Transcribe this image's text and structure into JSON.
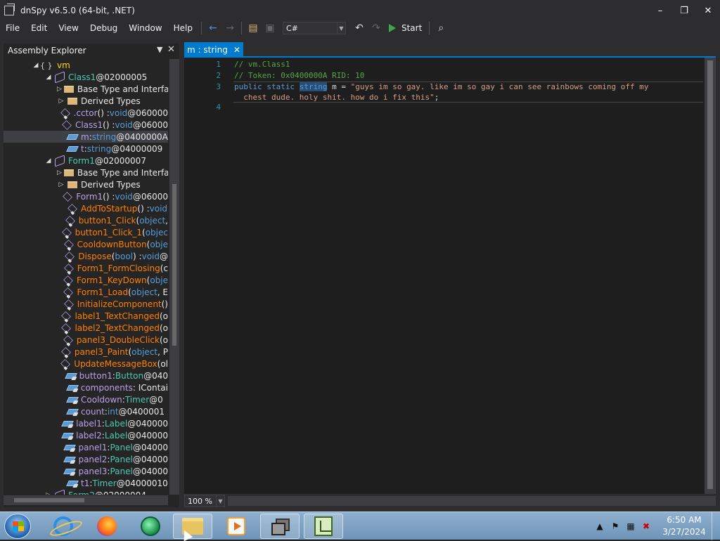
{
  "window": {
    "title": "dnSpy v6.5.0 (64-bit, .NET)"
  },
  "menu": [
    "File",
    "Edit",
    "View",
    "Debug",
    "Window",
    "Help"
  ],
  "toolbar": {
    "language": "C#",
    "start_label": "Start"
  },
  "explorer": {
    "title": "Assembly Explorer"
  },
  "tree": [
    {
      "indent": 48,
      "expand": "◢",
      "icon": "ns",
      "segments": [
        {
          "t": "vm",
          "c": "t-ns"
        }
      ]
    },
    {
      "indent": 66,
      "expand": "◢",
      "icon": "class",
      "segments": [
        {
          "t": "Class1",
          "c": "t-type"
        },
        {
          "t": " @02000005",
          "c": "t-token"
        }
      ]
    },
    {
      "indent": 84,
      "expand": "▷",
      "icon": "folder",
      "segments": [
        {
          "t": "Base Type and Interfac",
          "c": "t-white"
        }
      ]
    },
    {
      "indent": 84,
      "expand": "▷",
      "icon": "folder",
      "segments": [
        {
          "t": "Derived Types",
          "c": "t-white"
        }
      ]
    },
    {
      "indent": 84,
      "expand": "",
      "icon": "method-lock",
      "segments": [
        {
          "t": ".cctor",
          "c": "t-methodp"
        },
        {
          "t": "() : ",
          "c": "t-white"
        },
        {
          "t": "void",
          "c": "t-kw"
        },
        {
          "t": " @060000",
          "c": "t-token"
        }
      ]
    },
    {
      "indent": 84,
      "expand": "",
      "icon": "method",
      "segments": [
        {
          "t": "Class1",
          "c": "t-methodp"
        },
        {
          "t": "() : ",
          "c": "t-white"
        },
        {
          "t": "void",
          "c": "t-kw"
        },
        {
          "t": " @06000",
          "c": "t-token"
        }
      ]
    },
    {
      "indent": 84,
      "expand": "",
      "icon": "field",
      "selected": true,
      "segments": [
        {
          "t": "m",
          "c": "t-field"
        },
        {
          "t": " : ",
          "c": "t-white"
        },
        {
          "t": "string",
          "c": "t-kw"
        },
        {
          "t": " @0400000A",
          "c": "t-token"
        }
      ]
    },
    {
      "indent": 84,
      "expand": "",
      "icon": "field",
      "segments": [
        {
          "t": "t",
          "c": "t-field"
        },
        {
          "t": " : ",
          "c": "t-white"
        },
        {
          "t": "string",
          "c": "t-kw"
        },
        {
          "t": " @04000009",
          "c": "t-token"
        }
      ]
    },
    {
      "indent": 66,
      "expand": "◢",
      "icon": "class",
      "segments": [
        {
          "t": "Form1",
          "c": "t-type"
        },
        {
          "t": " @02000007",
          "c": "t-token"
        }
      ]
    },
    {
      "indent": 84,
      "expand": "▷",
      "icon": "folder",
      "segments": [
        {
          "t": "Base Type and Interfac",
          "c": "t-white"
        }
      ]
    },
    {
      "indent": 84,
      "expand": "▷",
      "icon": "folder",
      "segments": [
        {
          "t": "Derived Types",
          "c": "t-white"
        }
      ]
    },
    {
      "indent": 84,
      "expand": "",
      "icon": "method",
      "segments": [
        {
          "t": "Form1",
          "c": "t-methodp"
        },
        {
          "t": "() : ",
          "c": "t-white"
        },
        {
          "t": "void",
          "c": "t-kw"
        },
        {
          "t": " @06000",
          "c": "t-token"
        }
      ]
    },
    {
      "indent": 84,
      "expand": "",
      "icon": "method-lock",
      "segments": [
        {
          "t": "AddToStartup",
          "c": "t-method"
        },
        {
          "t": "() : ",
          "c": "t-white"
        },
        {
          "t": "void",
          "c": "t-kw"
        }
      ]
    },
    {
      "indent": 84,
      "expand": "",
      "icon": "method-lock",
      "segments": [
        {
          "t": "button1_Click",
          "c": "t-method"
        },
        {
          "t": "(",
          "c": "t-white"
        },
        {
          "t": "object",
          "c": "t-kw"
        },
        {
          "t": ",",
          "c": "t-white"
        }
      ]
    },
    {
      "indent": 84,
      "expand": "",
      "icon": "method-lock",
      "segments": [
        {
          "t": "button1_Click_1",
          "c": "t-method"
        },
        {
          "t": "(",
          "c": "t-white"
        },
        {
          "t": "objec",
          "c": "t-kw"
        }
      ]
    },
    {
      "indent": 84,
      "expand": "",
      "icon": "method-lock",
      "segments": [
        {
          "t": "CooldownButton",
          "c": "t-method"
        },
        {
          "t": "(",
          "c": "t-white"
        },
        {
          "t": "obje",
          "c": "t-kw"
        }
      ]
    },
    {
      "indent": 84,
      "expand": "",
      "icon": "method-lock",
      "segments": [
        {
          "t": "Dispose",
          "c": "t-method"
        },
        {
          "t": "(",
          "c": "t-white"
        },
        {
          "t": "bool",
          "c": "t-kw"
        },
        {
          "t": ") : ",
          "c": "t-white"
        },
        {
          "t": "void",
          "c": "t-kw"
        },
        {
          "t": " @",
          "c": "t-token"
        }
      ]
    },
    {
      "indent": 84,
      "expand": "",
      "icon": "method-lock",
      "segments": [
        {
          "t": "Form1_FormClosing",
          "c": "t-method"
        },
        {
          "t": "(c",
          "c": "t-white"
        }
      ]
    },
    {
      "indent": 84,
      "expand": "",
      "icon": "method-lock",
      "segments": [
        {
          "t": "Form1_KeyDown",
          "c": "t-method"
        },
        {
          "t": "(",
          "c": "t-white"
        },
        {
          "t": "obje",
          "c": "t-kw"
        }
      ]
    },
    {
      "indent": 84,
      "expand": "",
      "icon": "method-lock",
      "segments": [
        {
          "t": "Form1_Load",
          "c": "t-method"
        },
        {
          "t": "(",
          "c": "t-white"
        },
        {
          "t": "object",
          "c": "t-kw"
        },
        {
          "t": ", E",
          "c": "t-white"
        }
      ]
    },
    {
      "indent": 84,
      "expand": "",
      "icon": "method-lock",
      "segments": [
        {
          "t": "InitializeComponent",
          "c": "t-method"
        },
        {
          "t": "()",
          "c": "t-white"
        }
      ]
    },
    {
      "indent": 84,
      "expand": "",
      "icon": "method-lock",
      "segments": [
        {
          "t": "label1_TextChanged",
          "c": "t-method"
        },
        {
          "t": "(o",
          "c": "t-white"
        }
      ]
    },
    {
      "indent": 84,
      "expand": "",
      "icon": "method-lock",
      "segments": [
        {
          "t": "label2_TextChanged",
          "c": "t-method"
        },
        {
          "t": "(o",
          "c": "t-white"
        }
      ]
    },
    {
      "indent": 84,
      "expand": "",
      "icon": "method-lock",
      "segments": [
        {
          "t": "panel3_DoubleClick",
          "c": "t-method"
        },
        {
          "t": "(o",
          "c": "t-white"
        }
      ]
    },
    {
      "indent": 84,
      "expand": "",
      "icon": "method-lock",
      "segments": [
        {
          "t": "panel3_Paint",
          "c": "t-method"
        },
        {
          "t": "(",
          "c": "t-white"
        },
        {
          "t": "object",
          "c": "t-kw"
        },
        {
          "t": ", P",
          "c": "t-white"
        }
      ]
    },
    {
      "indent": 84,
      "expand": "",
      "icon": "method-lock",
      "segments": [
        {
          "t": "UpdateMessageBox",
          "c": "t-method"
        },
        {
          "t": "(ol",
          "c": "t-white"
        }
      ]
    },
    {
      "indent": 84,
      "expand": "",
      "icon": "field-lock",
      "segments": [
        {
          "t": "button1",
          "c": "t-field"
        },
        {
          "t": " : ",
          "c": "t-white"
        },
        {
          "t": "Button",
          "c": "t-type"
        },
        {
          "t": " @040",
          "c": "t-token"
        }
      ]
    },
    {
      "indent": 84,
      "expand": "",
      "icon": "field-lock",
      "segments": [
        {
          "t": "components",
          "c": "t-field"
        },
        {
          "t": " : IContai",
          "c": "t-white"
        }
      ]
    },
    {
      "indent": 84,
      "expand": "",
      "icon": "field-lock",
      "segments": [
        {
          "t": "Cooldown",
          "c": "t-field"
        },
        {
          "t": " : ",
          "c": "t-white"
        },
        {
          "t": "Timer",
          "c": "t-type"
        },
        {
          "t": " @0",
          "c": "t-token"
        }
      ]
    },
    {
      "indent": 84,
      "expand": "",
      "icon": "field-lock",
      "segments": [
        {
          "t": "count",
          "c": "t-field"
        },
        {
          "t": " : ",
          "c": "t-white"
        },
        {
          "t": "int",
          "c": "t-kw"
        },
        {
          "t": " @0400001",
          "c": "t-token"
        }
      ]
    },
    {
      "indent": 84,
      "expand": "",
      "icon": "field-lock",
      "segments": [
        {
          "t": "label1",
          "c": "t-field"
        },
        {
          "t": " : ",
          "c": "t-white"
        },
        {
          "t": "Label",
          "c": "t-type"
        },
        {
          "t": " @040000",
          "c": "t-token"
        }
      ]
    },
    {
      "indent": 84,
      "expand": "",
      "icon": "field-lock",
      "segments": [
        {
          "t": "label2",
          "c": "t-field"
        },
        {
          "t": " : ",
          "c": "t-white"
        },
        {
          "t": "Label",
          "c": "t-type"
        },
        {
          "t": " @040000",
          "c": "t-token"
        }
      ]
    },
    {
      "indent": 84,
      "expand": "",
      "icon": "field-lock",
      "segments": [
        {
          "t": "panel1",
          "c": "t-field"
        },
        {
          "t": " : ",
          "c": "t-white"
        },
        {
          "t": "Panel",
          "c": "t-type"
        },
        {
          "t": " @04000",
          "c": "t-token"
        }
      ]
    },
    {
      "indent": 84,
      "expand": "",
      "icon": "field-lock",
      "segments": [
        {
          "t": "panel2",
          "c": "t-field"
        },
        {
          "t": " : ",
          "c": "t-white"
        },
        {
          "t": "Panel",
          "c": "t-type"
        },
        {
          "t": " @04000",
          "c": "t-token"
        }
      ]
    },
    {
      "indent": 84,
      "expand": "",
      "icon": "field-lock",
      "segments": [
        {
          "t": "panel3",
          "c": "t-field"
        },
        {
          "t": " : ",
          "c": "t-white"
        },
        {
          "t": "Panel",
          "c": "t-type"
        },
        {
          "t": " @04000",
          "c": "t-token"
        }
      ]
    },
    {
      "indent": 84,
      "expand": "",
      "icon": "field-lock",
      "segments": [
        {
          "t": "t1",
          "c": "t-field"
        },
        {
          "t": " : ",
          "c": "t-white"
        },
        {
          "t": "Timer",
          "c": "t-type"
        },
        {
          "t": " @04000010",
          "c": "t-token"
        }
      ]
    },
    {
      "indent": 66,
      "expand": "▷",
      "icon": "class",
      "segments": [
        {
          "t": "Form2",
          "c": "t-type"
        },
        {
          "t": " @02000004",
          "c": "t-token"
        }
      ]
    }
  ],
  "tab": {
    "label": "m : string"
  },
  "code": {
    "line_numbers": [
      "1",
      "2",
      "3",
      "",
      "4"
    ],
    "line1": "// vm.Class1",
    "line2": "// Token: 0x0400000A RID: 10",
    "line3_kw1": "public static ",
    "line3_type": "string",
    "line3_mid": " m = ",
    "line3_str": "\"guys im so gay. like im so gay i can see rainbows coming off my",
    "line3b_str": "  chest dude. holy shit. how do i fix this\"",
    "line3b_end": ";"
  },
  "zoom": "100 %",
  "taskbar": {
    "time": "6:50 AM",
    "date": "3/27/2024"
  }
}
